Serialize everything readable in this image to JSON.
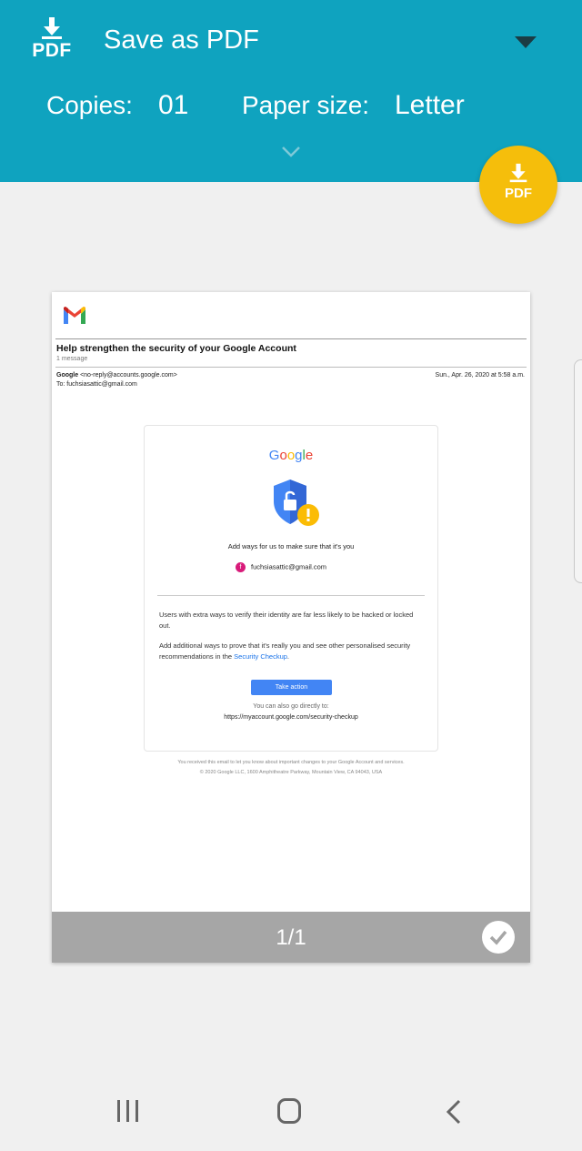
{
  "header": {
    "pdf_icon_label": "PDF",
    "printer_name": "Save as PDF",
    "copies_label": "Copies:",
    "copies_value": "01",
    "paper_size_label": "Paper size:",
    "paper_size_value": "Letter"
  },
  "fab": {
    "label": "PDF"
  },
  "preview": {
    "email_subject": "Help strengthen the security of your Google Account",
    "message_count": "1 message",
    "from_name": "Google",
    "from_address": "<no-reply@accounts.google.com>",
    "to_line": "To: fuchsiasattic@gmail.com",
    "date": "Sun., Apr. 26, 2020 at 5:58 a.m.",
    "card": {
      "brand": [
        "G",
        "o",
        "o",
        "g",
        "l",
        "e"
      ],
      "brand_colors": [
        "#4285f4",
        "#ea4335",
        "#fbbc05",
        "#4285f4",
        "#34a853",
        "#ea4335"
      ],
      "headline": "Add ways for us to make sure that it's you",
      "avatar_letter": "f",
      "account_email": "fuchsiasattic@gmail.com",
      "paragraph1": "Users with extra ways to verify their identity are far less likely to be hacked or locked out.",
      "paragraph2_text": "Add additional ways to prove that it's really you and see other personalised security recommendations in the ",
      "paragraph2_link": "Security Checkup",
      "paragraph2_end": ".",
      "button_label": "Take action",
      "also_go": "You can also go directly to:",
      "direct_url": "https://myaccount.google.com/security-checkup"
    },
    "footer_line1": "You received this email to let you know about important changes to your Google Account and services.",
    "footer_line2": "© 2020 Google LLC, 1600 Amphitheatre Parkway, Mountain View, CA 94043, USA",
    "page_indicator": "1/1"
  },
  "colors": {
    "header_bg": "#0fa3bf",
    "fab_bg": "#f5be0b",
    "page_bar_bg": "#a6a6a6",
    "link": "#1a73e8"
  },
  "icons": [
    "download-pdf-icon",
    "dropdown-arrow-icon",
    "chevron-down-icon",
    "gmail-logo",
    "shield-alert-icon",
    "checkmark-icon",
    "recents-icon",
    "home-icon",
    "back-icon"
  ]
}
